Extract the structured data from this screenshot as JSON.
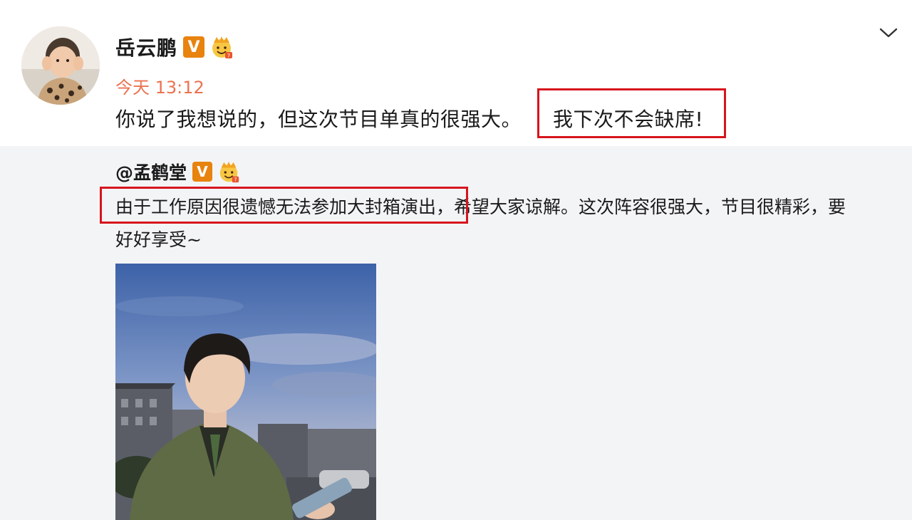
{
  "post": {
    "username": "岳云鹏",
    "verified_mark": "V",
    "time": "今天 13:12",
    "text_plain": "你说了我想说的，但这次节目单真的很强大。",
    "text_highlight": "我下次不会缺席!"
  },
  "repost": {
    "username": "@孟鹤堂",
    "verified_mark": "V",
    "line1_highlight": "由于工作原因很遗憾无法参加大封箱演出，",
    "line1_rest": "希望大家谅解。这次阵容很强大，节目很精彩，要",
    "line2": "好好享受~"
  },
  "colors": {
    "time": "#eb7350",
    "badge": "#e8830e",
    "highlight_border": "#d7151d",
    "repost_bg": "#f3f4f6"
  },
  "icons": {
    "chevron": "chevron-down-icon",
    "verified": "verified-v-icon",
    "crown": "member-crown-icon"
  }
}
